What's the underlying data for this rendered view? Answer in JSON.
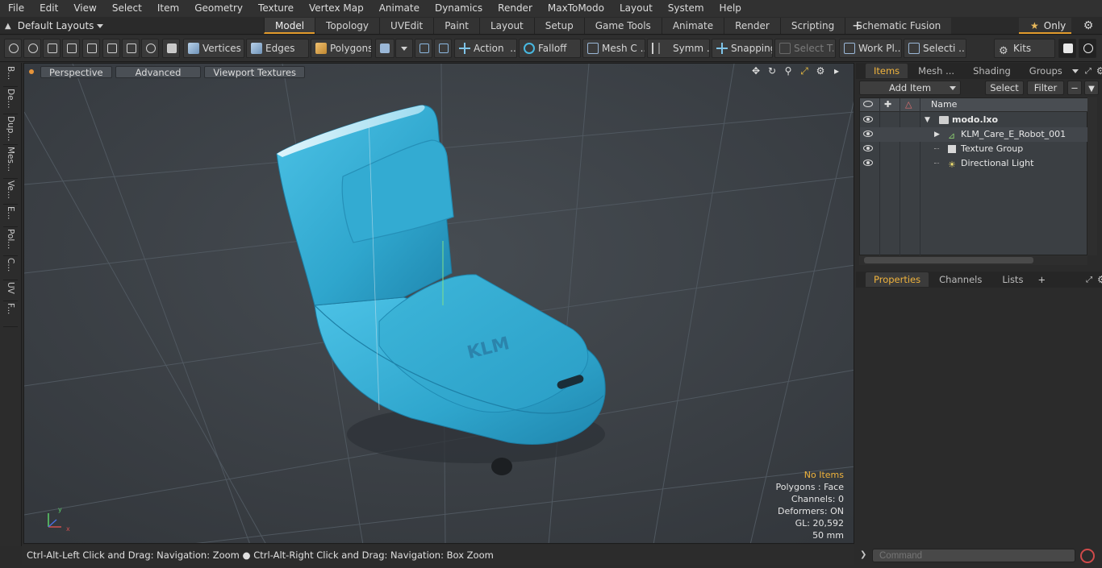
{
  "menu": [
    "File",
    "Edit",
    "View",
    "Select",
    "Item",
    "Geometry",
    "Texture",
    "Vertex Map",
    "Animate",
    "Dynamics",
    "Render",
    "MaxToModo",
    "Layout",
    "System",
    "Help"
  ],
  "layouts": {
    "label": "Default Layouts"
  },
  "tabs": [
    "Model",
    "Topology",
    "UVEdit",
    "Paint",
    "Layout",
    "Setup",
    "Game Tools",
    "Animate",
    "Render",
    "Scripting",
    "Schematic Fusion"
  ],
  "active_tab": "Model",
  "only_label": "Only",
  "toolbar": {
    "vertices": "Vertices",
    "edges": "Edges",
    "polygons": "Polygons",
    "action": "Action",
    "falloff": "Falloff",
    "mesh": "Mesh C ...",
    "symm": "Symm ...",
    "snapping": "Snapping",
    "select_t": "Select T...",
    "work_pl": "Work Pl...",
    "selecti": "Selecti ...",
    "kits": "Kits"
  },
  "left_tabs": [
    "B...",
    "De...",
    "Dup...",
    "Mes...",
    "Ve...",
    "E...",
    "Pol...",
    "C...",
    "UV",
    "F..."
  ],
  "viewport": {
    "perspective": "Perspective",
    "advanced": "Advanced",
    "textures": "Viewport Textures",
    "model_text": "KLM",
    "stats": {
      "no_items": "No Items",
      "polygons": "Polygons : Face",
      "channels": "Channels: 0",
      "deformers": "Deformers: ON",
      "gl": "GL: 20,592",
      "size": "50 mm"
    }
  },
  "status": "Ctrl-Alt-Left Click and Drag: Navigation: Zoom ● Ctrl-Alt-Right Click and Drag: Navigation: Box Zoom",
  "items_panel": {
    "tabs": [
      "Items",
      "Mesh ...",
      "Shading",
      "Groups"
    ],
    "add_item": "Add Item",
    "select": "Select",
    "filter": "Filter",
    "name_header": "Name",
    "rows": [
      {
        "name": "modo.lxo",
        "bold": true
      },
      {
        "name": "KLM_Care_E_Robot_001",
        "bold": false
      },
      {
        "name": "Texture Group",
        "bold": false
      },
      {
        "name": "Directional Light",
        "bold": false
      }
    ]
  },
  "props_panel": {
    "tabs": [
      "Properties",
      "Channels",
      "Lists"
    ]
  },
  "command_placeholder": "Command",
  "colors": {
    "accent": "#e29b2c",
    "model": "#35a9cf",
    "viewport_bg": "#3a3f44"
  }
}
